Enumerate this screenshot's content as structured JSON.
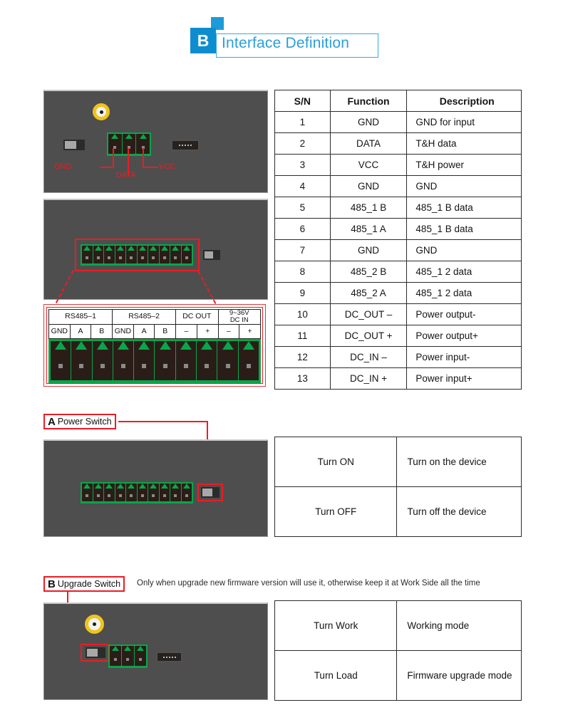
{
  "header": {
    "badge_letter": "B",
    "title": "Interface Definition"
  },
  "photo1": {
    "labels": {
      "gnd": "GND",
      "data": "DATA",
      "vcc": "VCC"
    }
  },
  "main_table": {
    "headers": [
      "S/N",
      "Function",
      "Description"
    ],
    "rows": [
      [
        "1",
        "GND",
        "GND for input"
      ],
      [
        "2",
        "DATA",
        "T&H data"
      ],
      [
        "3",
        "VCC",
        "T&H power"
      ],
      [
        "4",
        "GND",
        "GND"
      ],
      [
        "5",
        "485_1  B",
        "485_1 B data"
      ],
      [
        "6",
        "485_1  A",
        "485_1 B data"
      ],
      [
        "7",
        "GND",
        "GND"
      ],
      [
        "8",
        "485_2  B",
        "485_1 2 data"
      ],
      [
        "9",
        "485_2  A",
        "485_1 2 data"
      ],
      [
        "10",
        "DC_OUT –",
        "Power output-"
      ],
      [
        "11",
        "DC_OUT +",
        "Power output+"
      ],
      [
        "12",
        "DC_IN –",
        "Power  input-"
      ],
      [
        "13",
        "DC_IN +",
        "Power input+"
      ]
    ]
  },
  "connector_detail": {
    "groups": [
      {
        "label": "RS485–1",
        "span": 3
      },
      {
        "label": "RS485–2",
        "span": 3
      },
      {
        "label": "DC OUT",
        "span": 2
      },
      {
        "label": "9~36V\nDC IN",
        "span": 2
      }
    ],
    "group_labels": [
      "RS485–1",
      "RS485–2",
      "DC OUT",
      "9~36V DC IN"
    ],
    "dc_in_line1": "9~36V",
    "dc_in_line2": "DC IN",
    "pins": [
      "GND",
      "A",
      "B",
      "GND",
      "A",
      "B",
      "–",
      "+",
      "–",
      "+"
    ],
    "pin_count": 10
  },
  "power_switch": {
    "tag_letter": "A",
    "tag_text": "Power Switch",
    "table": {
      "rows": [
        [
          "Turn ON",
          "Turn on the device"
        ],
        [
          "Turn OFF",
          "Turn off the device"
        ]
      ]
    }
  },
  "upgrade_switch": {
    "tag_letter": "B",
    "tag_text": "Upgrade Switch",
    "note": "Only when upgrade new firmware version will use it, otherwise keep it at Work Side all the time",
    "table": {
      "rows": [
        [
          "Turn Work",
          "Working mode"
        ],
        [
          "Turn Load",
          "Firmware upgrade mode"
        ]
      ]
    }
  },
  "colors": {
    "accent_blue": "#2a9fdc",
    "badge_blue": "#0d8dd0",
    "annotation_red": "#ec1c24",
    "terminal_green": "#0aa54a",
    "panel_gray": "#4e4e4e"
  }
}
